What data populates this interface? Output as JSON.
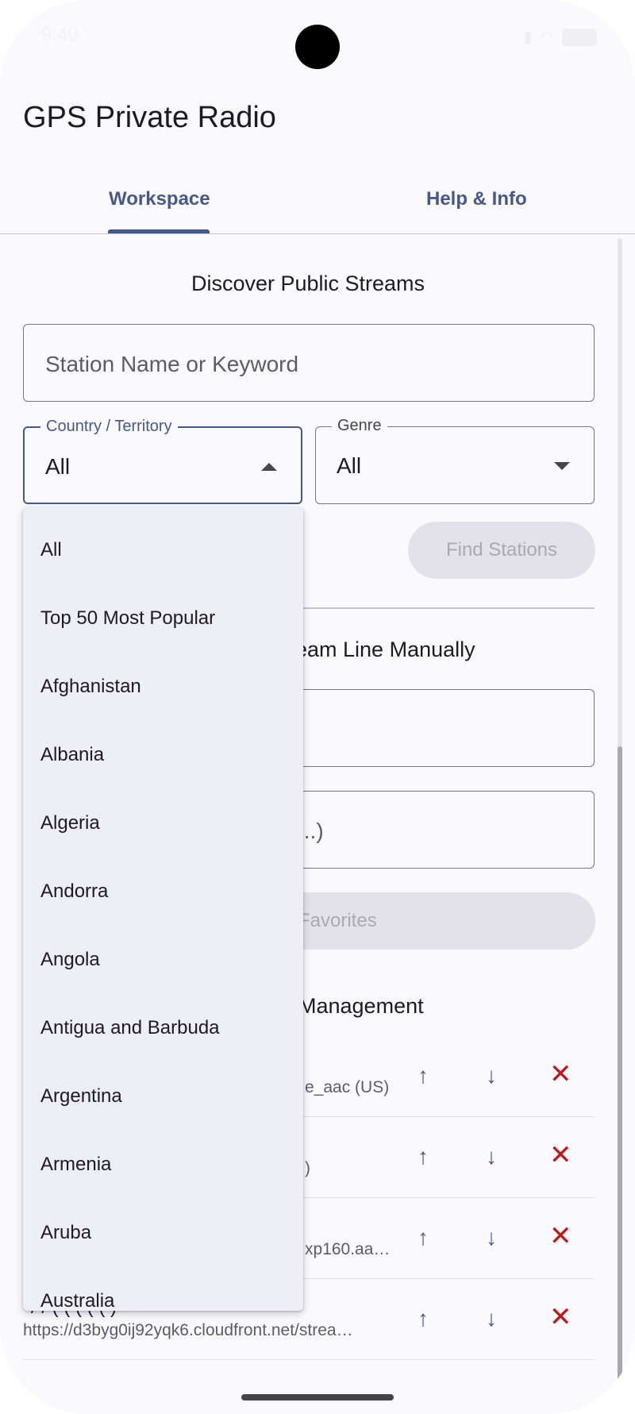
{
  "status_bar": {
    "time": "9:40"
  },
  "app": {
    "title": "GPS Private Radio"
  },
  "tabs": [
    {
      "label": "Workspace",
      "selected": true
    },
    {
      "label": "Help & Info",
      "selected": false
    }
  ],
  "discover": {
    "title": "Discover Public Streams",
    "keyword_placeholder": "Station Name or Keyword",
    "country": {
      "label": "Country / Territory",
      "value": "All"
    },
    "genre": {
      "label": "Genre",
      "value": "All"
    },
    "find_button": "Find Stations"
  },
  "manual": {
    "title_visible": "eam Line Manually",
    "field2_placeholder_visible": "...)",
    "favorites_button_visible": "Favorites"
  },
  "management": {
    "title_visible": "Management",
    "rows": [
      {
        "url_visible": "e_aac (US)"
      },
      {
        "url_visible": ")"
      },
      {
        "url_visible": "xp160.aa…"
      },
      {
        "name_visible": "/ / ( ( ( ( ( )",
        "url": "https://d3byg0ij92yqk6.cloudfront.net/strea…"
      }
    ]
  },
  "country_menu": {
    "items": [
      "All",
      "Top 50 Most Popular",
      "Afghanistan",
      "Albania",
      "Algeria",
      "Andorra",
      "Angola",
      "Antigua and Barbuda",
      "Argentina",
      "Armenia",
      "Aruba",
      "Australia"
    ]
  },
  "icons": {
    "move_up": "arrow-up-icon",
    "move_down": "arrow-down-icon",
    "delete": "close-icon"
  },
  "colors": {
    "accent": "#46578a",
    "delete": "#ba1a1a",
    "background": "#faf9fd",
    "menu_bg": "#eeeef7",
    "disabled_button": "#e3e2e8"
  }
}
